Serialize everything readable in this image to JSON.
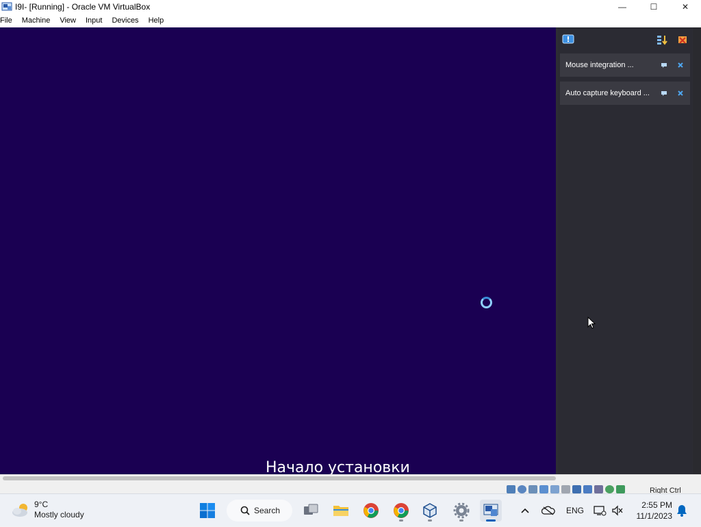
{
  "window": {
    "title": "I9I- [Running] - Oracle VM VirtualBox",
    "controls": {
      "minimize": "—",
      "maximize": "☐",
      "close": "✕"
    }
  },
  "menubar": {
    "items": [
      "File",
      "Machine",
      "View",
      "Input",
      "Devices",
      "Help"
    ]
  },
  "vm": {
    "caption": "Начало установки"
  },
  "notifications": {
    "items": [
      {
        "text": "Mouse integration ..."
      },
      {
        "text": "Auto capture keyboard ..."
      }
    ]
  },
  "statusbar": {
    "host_key": "Right Ctrl"
  },
  "taskbar": {
    "weather": {
      "temp": "9°C",
      "condition": "Mostly cloudy"
    },
    "search_label": "Search",
    "language": "ENG",
    "time": "2:55 PM",
    "date": "11/1/2023"
  },
  "colors": {
    "vm_background": "#1a0052",
    "notif_panel": "#2d2d34",
    "accent": "#005fb8"
  }
}
